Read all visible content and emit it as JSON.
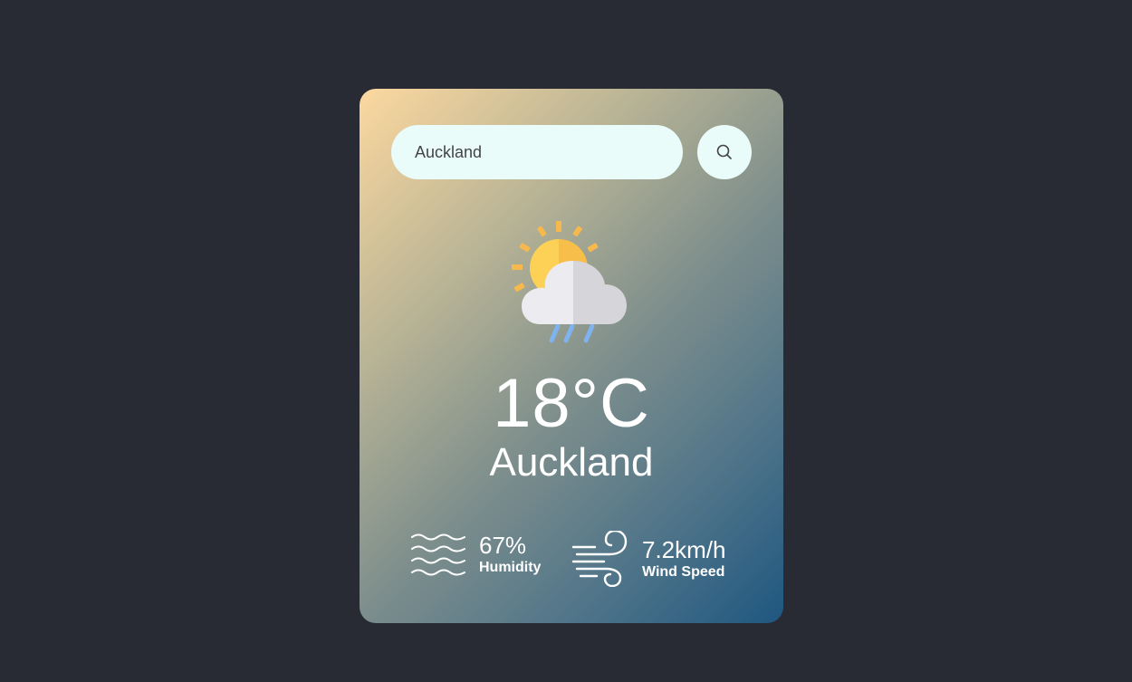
{
  "search": {
    "value": "Auckland",
    "button_icon": "search-icon"
  },
  "weather": {
    "icon": "sun-cloud-rain-icon",
    "temperature": "18°C",
    "city": "Auckland"
  },
  "details": {
    "humidity": {
      "icon": "humidity-waves-icon",
      "value": "67%",
      "label": "Humidity"
    },
    "wind": {
      "icon": "wind-icon",
      "value": "7.2km/h",
      "label": "Wind Speed"
    }
  },
  "colors": {
    "page_background": "#282b33",
    "gradient_start": "#fcd89f",
    "gradient_end": "#1f5780",
    "input_background": "#e9fcfa"
  }
}
